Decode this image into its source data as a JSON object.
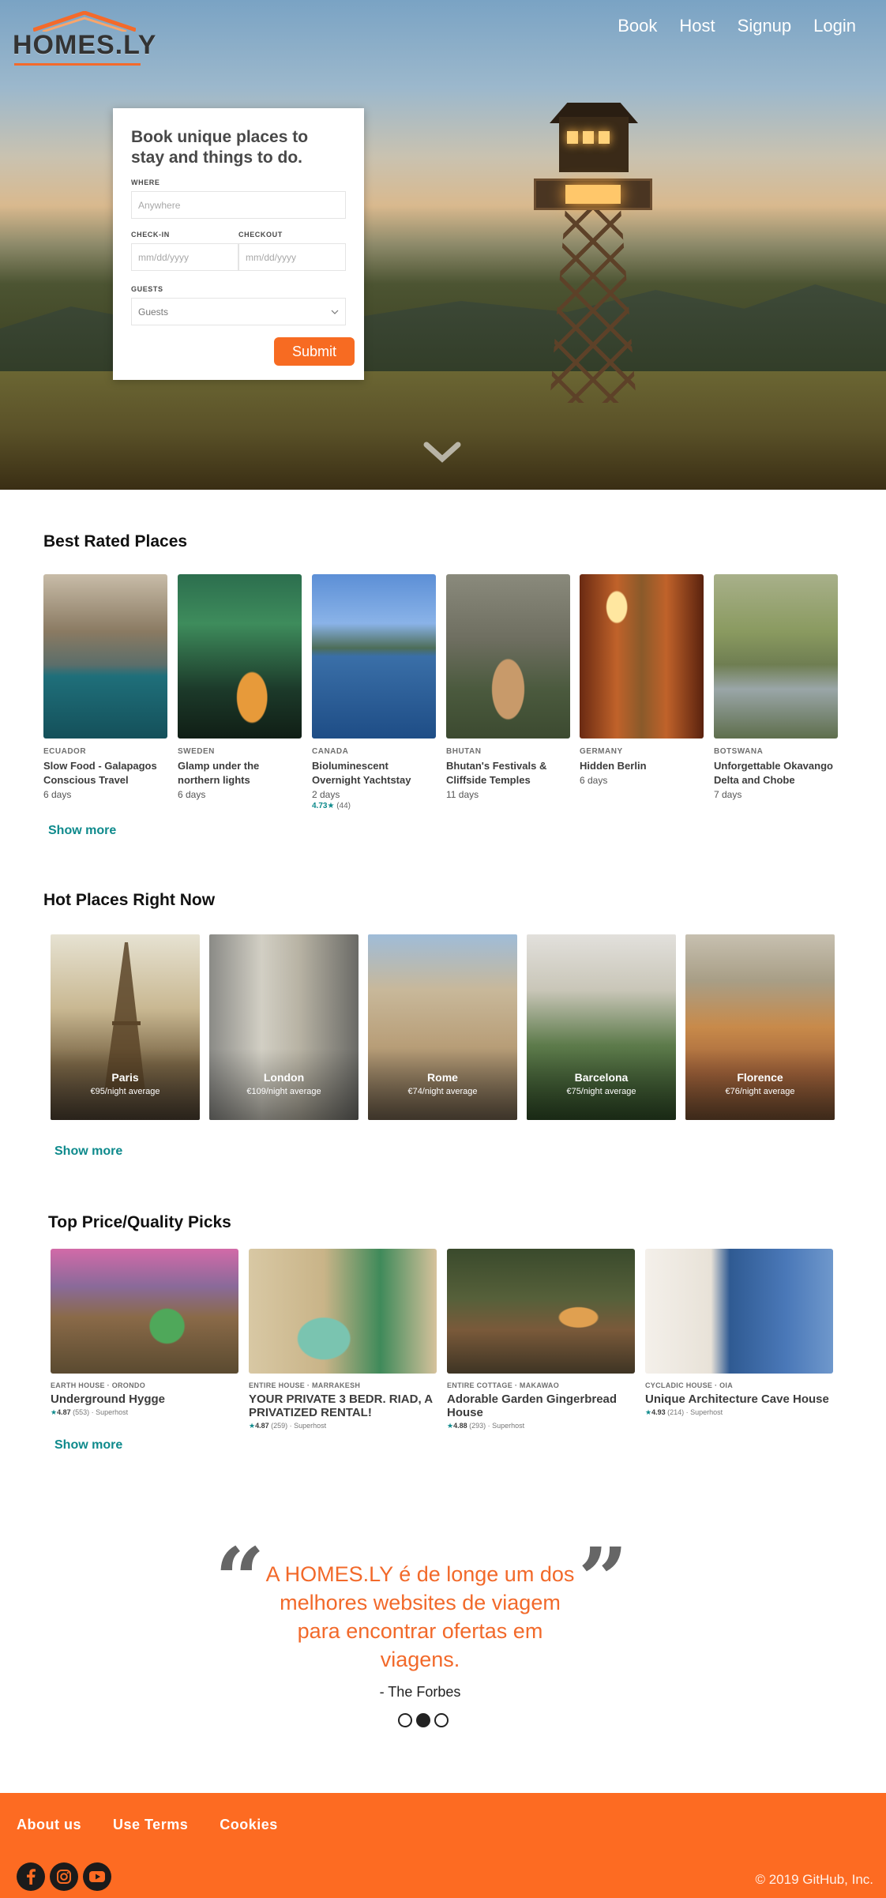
{
  "brand": {
    "logo_text": "HOMES.LY"
  },
  "nav": {
    "items": [
      "Book",
      "Host",
      "Signup",
      "Login"
    ]
  },
  "booking": {
    "title": "Book unique places to stay and things to do.",
    "where_label": "WHERE",
    "where_placeholder": "Anywhere",
    "checkin_label": "CHECK-IN",
    "checkin_placeholder": "mm/dd/yyyy",
    "checkout_label": "CHECKOUT",
    "checkout_placeholder": "mm/dd/yyyy",
    "guests_label": "GUESTS",
    "guests_value": "Guests",
    "submit_label": "Submit"
  },
  "best_rated": {
    "title": "Best Rated Places",
    "show_more": "Show more",
    "items": [
      {
        "country": "ECUADOR",
        "name": "Slow Food - Galapagos Conscious Travel",
        "days": "6 days"
      },
      {
        "country": "SWEDEN",
        "name": "Glamp under the northern lights",
        "days": "6 days"
      },
      {
        "country": "CANADA",
        "name": "Bioluminescent Overnight Yachtstay",
        "days": "2 days",
        "rating": "4.73",
        "reviews": "(44)"
      },
      {
        "country": "BHUTAN",
        "name": "Bhutan's Festivals & Cliffside Temples",
        "days": "11 days"
      },
      {
        "country": "GERMANY",
        "name": "Hidden Berlin",
        "days": "6 days"
      },
      {
        "country": "BOTSWANA",
        "name": "Unforgettable Okavango Delta and Chobe",
        "days": "7 days"
      }
    ]
  },
  "hot_places": {
    "title": "Hot Places Right Now",
    "show_more": "Show more",
    "items": [
      {
        "name": "Paris",
        "price": "€95/night average"
      },
      {
        "name": "London",
        "price": "€109/night average"
      },
      {
        "name": "Rome",
        "price": "€74/night average"
      },
      {
        "name": "Barcelona",
        "price": "€75/night average"
      },
      {
        "name": "Florence",
        "price": "€76/night average"
      }
    ]
  },
  "top_picks": {
    "title": "Top Price/Quality Picks",
    "show_more": "Show more",
    "items": [
      {
        "type": "EARTH HOUSE · ORONDO",
        "name": "Underground Hygge",
        "rating": "4.87",
        "reviews": "(553)",
        "badge": "· Superhost"
      },
      {
        "type": "ENTIRE HOUSE · MARRAKESH",
        "name": "YOUR PRIVATE 3 BEDR. RIAD, A PRIVATIZED RENTAL!",
        "rating": "4.87",
        "reviews": "(259)",
        "badge": "· Superhost"
      },
      {
        "type": "ENTIRE COTTAGE · MAKAWAO",
        "name": "Adorable Garden Gingerbread House",
        "rating": "4.88",
        "reviews": "(293)",
        "badge": "· Superhost"
      },
      {
        "type": "CYCLADIC HOUSE · OIA",
        "name": "Unique Architecture Cave House",
        "rating": "4.93",
        "reviews": "(214)",
        "badge": "· Superhost"
      }
    ]
  },
  "testimonial": {
    "quote": "A HOMES.LY é de longe um dos melhores websites de viagem para encontrar ofertas em viagens.",
    "author": "- The Forbes",
    "open_mark": "“",
    "close_mark": "”"
  },
  "footer": {
    "links": [
      "About us",
      "Use Terms",
      "Cookies"
    ],
    "copyright": "© 2019 GitHub, Inc.",
    "social_icons": [
      "facebook-icon",
      "instagram-icon",
      "youtube-icon"
    ]
  },
  "colors": {
    "accent": "#f76b22",
    "link": "#0e8a8c",
    "footer": "#fd6b22"
  }
}
